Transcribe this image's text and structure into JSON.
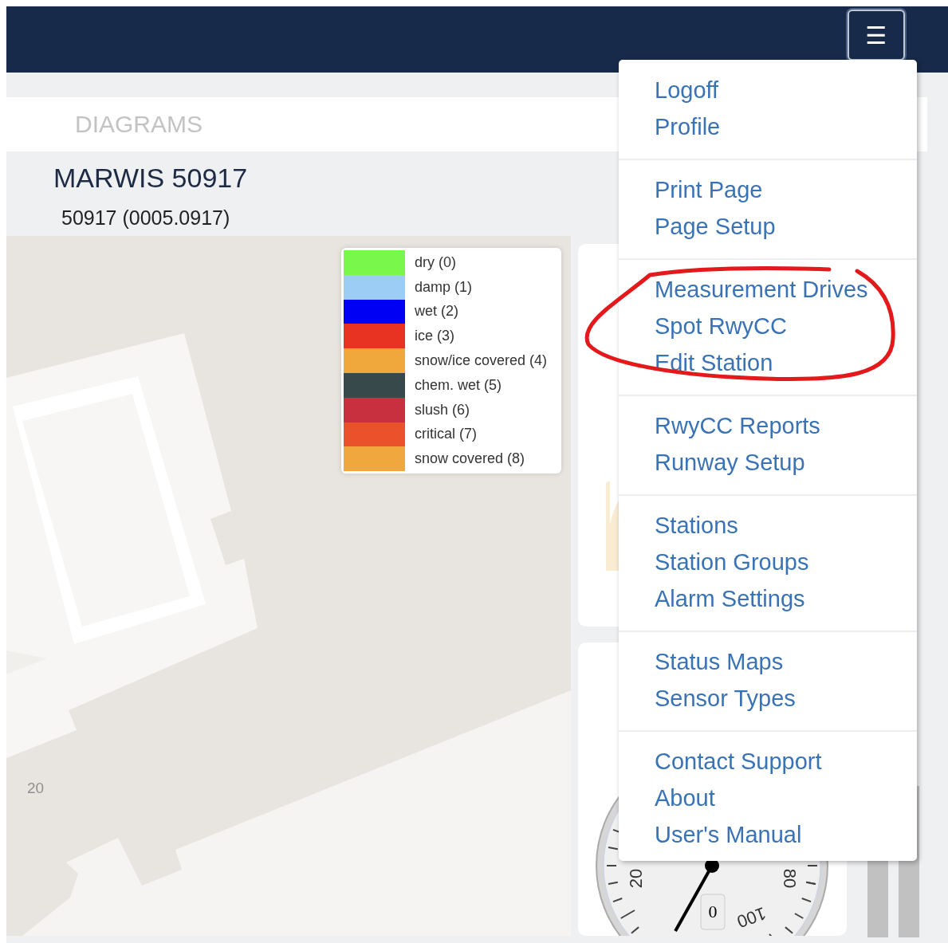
{
  "navbar": {
    "menu_button": {
      "label": "☰"
    }
  },
  "tab_bar": {
    "items": [
      {
        "label": "DIAGRAMS",
        "selected": false
      }
    ]
  },
  "station": {
    "title": "MARWIS 50917",
    "subtitle": "50917 (0005.0917)"
  },
  "map": {
    "label": "20",
    "legend": [
      {
        "label": "dry (0)",
        "color": "#79f74a"
      },
      {
        "label": "damp (1)",
        "color": "#9ccdf5"
      },
      {
        "label": "wet (2)",
        "color": "#0000f5"
      },
      {
        "label": "ice (3)",
        "color": "#e83323"
      },
      {
        "label": "snow/ice covered (4)",
        "color": "#f0a73c"
      },
      {
        "label": "chem. wet (5)",
        "color": "#37494a"
      },
      {
        "label": "slush (6)",
        "color": "#c9303f"
      },
      {
        "label": "critical (7)",
        "color": "#e9522a"
      },
      {
        "label": "snow covered (8)",
        "color": "#f0a73d"
      }
    ]
  },
  "gauge": {
    "reading": "0",
    "tick_labels": [
      "20",
      "80",
      "100"
    ]
  },
  "menu": {
    "groups": [
      [
        "Logoff",
        "Profile"
      ],
      [
        "Print Page",
        "Page Setup"
      ],
      [
        "Measurement Drives",
        "Spot RwyCC",
        "Edit Station"
      ],
      [
        "RwyCC Reports",
        "Runway Setup"
      ],
      [
        "Stations",
        "Station Groups",
        "Alarm Settings"
      ],
      [
        "Status Maps",
        "Sensor Types"
      ],
      [
        "Contact Support",
        "About",
        "User's Manual"
      ]
    ]
  }
}
